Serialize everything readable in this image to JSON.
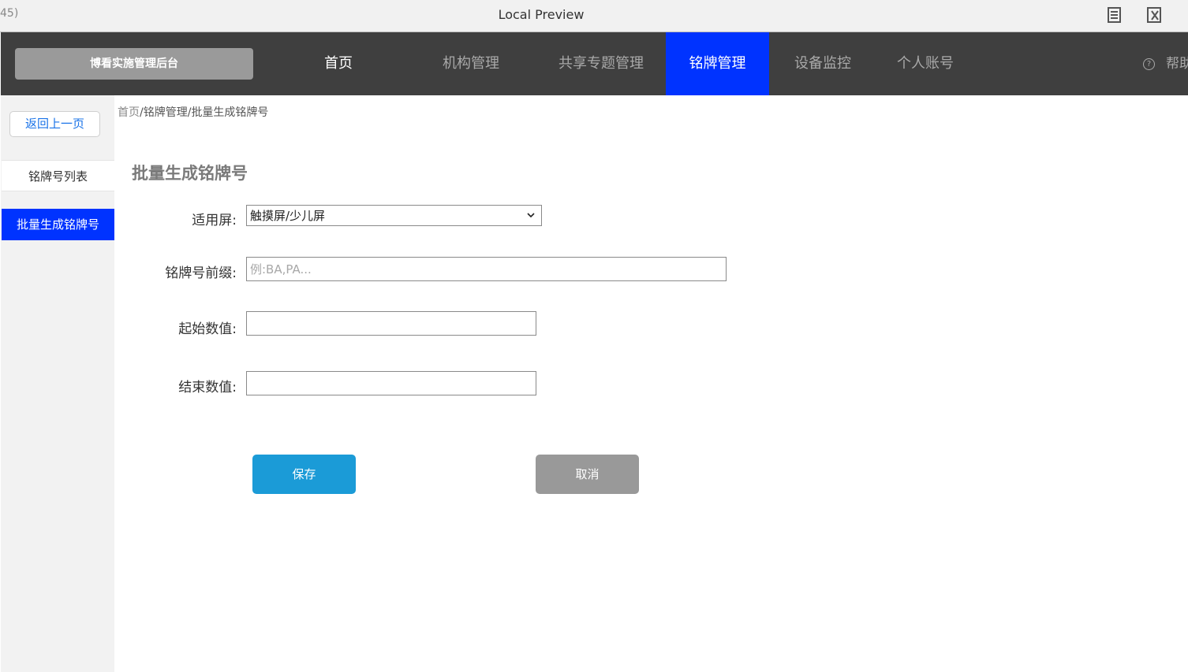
{
  "window": {
    "left_fragment": "45)",
    "title": "Local Preview",
    "icons": [
      "document-icon",
      "close-x-icon"
    ]
  },
  "topnav": {
    "brand": "博看实施管理后台",
    "items": [
      {
        "label": "首页"
      },
      {
        "label": "机构管理"
      },
      {
        "label": "共享专题管理"
      },
      {
        "label": "铭牌管理"
      },
      {
        "label": "设备监控"
      },
      {
        "label": "个人账号"
      }
    ],
    "active_index": 3,
    "help_label": "帮助",
    "help_icon": "question-circle-icon",
    "active_color": "#0033ff"
  },
  "sidebar": {
    "back_label": "返回上一页",
    "items": [
      {
        "label": "铭牌号列表"
      },
      {
        "label": "批量生成铭牌号"
      }
    ]
  },
  "breadcrumb": {
    "home": "首页",
    "separator": "/",
    "section": "铭牌管理",
    "current": "批量生成铭牌号"
  },
  "form": {
    "title": "批量生成铭牌号",
    "screen_label": "适用屏:",
    "screen_value": "触摸屏/少儿屏",
    "prefix_label": "铭牌号前缀:",
    "prefix_placeholder": "例:BA,PA...",
    "start_label": "起始数值:",
    "end_label": "结束数值:",
    "save_label": "保存",
    "cancel_label": "取消"
  }
}
